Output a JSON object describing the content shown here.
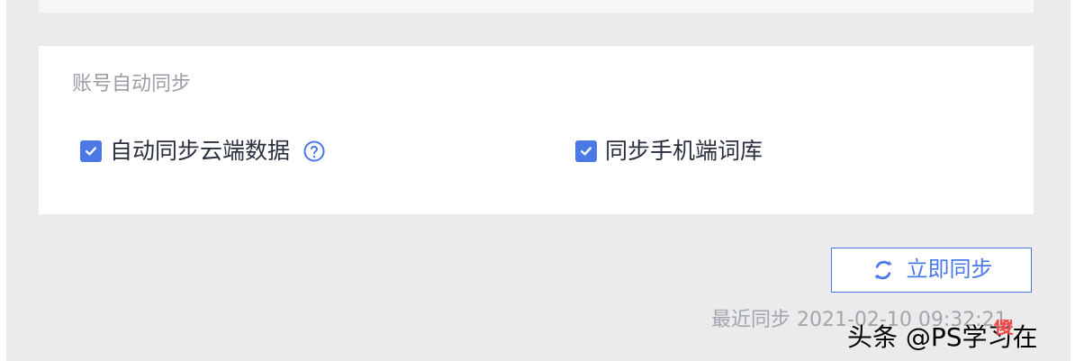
{
  "colors": {
    "accent": "#4a78e6",
    "background": "#ebebeb",
    "card_background": "#ffffff",
    "title_text": "#9a9da6",
    "body_text": "#2a2f3d",
    "muted_text": "#a1a5ad"
  },
  "account_sync": {
    "title": "账号自动同步",
    "options": [
      {
        "label": "自动同步云端数据",
        "checked": true,
        "has_help": true
      },
      {
        "label": "同步手机端词库",
        "checked": true,
        "has_help": false
      }
    ]
  },
  "actions": {
    "sync_now_label": "立即同步",
    "last_sync_text": "最近同步 2021-02-10 09:32:21"
  },
  "icons": {
    "checkbox": "checkmark-icon",
    "help": "question-circle-icon",
    "sync": "refresh-icon"
  },
  "watermark": {
    "text": "头条 @PS学习在",
    "badge": "傻"
  }
}
